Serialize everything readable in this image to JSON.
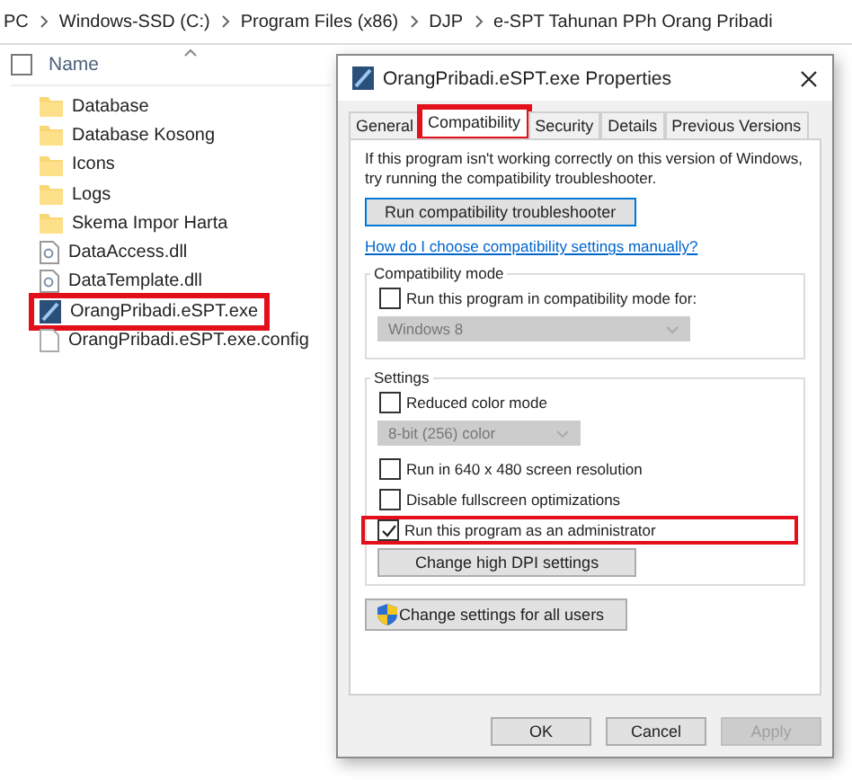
{
  "breadcrumb": [
    "PC",
    "Windows-SSD (C:)",
    "Program Files (x86)",
    "DJP",
    "e-SPT Tahunan PPh Orang Pribadi"
  ],
  "file_list": {
    "select_all": {
      "checked": false
    },
    "column": "Name",
    "items": [
      {
        "name": "Database",
        "kind": "folder",
        "highlighted": false
      },
      {
        "name": "Database Kosong",
        "kind": "folder",
        "highlighted": false
      },
      {
        "name": "Icons",
        "kind": "folder",
        "highlighted": false
      },
      {
        "name": "Logs",
        "kind": "folder",
        "highlighted": false
      },
      {
        "name": "Skema Impor Harta",
        "kind": "folder",
        "highlighted": false
      },
      {
        "name": "DataAccess.dll",
        "kind": "dll",
        "highlighted": false
      },
      {
        "name": "DataTemplate.dll",
        "kind": "dll",
        "highlighted": false
      },
      {
        "name": "OrangPribadi.eSPT.exe",
        "kind": "exe",
        "highlighted": true
      },
      {
        "name": "OrangPribadi.eSPT.exe.config",
        "kind": "file",
        "highlighted": false
      }
    ]
  },
  "dialog": {
    "title": "OrangPribadi.eSPT.exe Properties",
    "tabs": [
      {
        "label": "General",
        "selected": false,
        "highlighted": false
      },
      {
        "label": "Compatibility",
        "selected": true,
        "highlighted": true
      },
      {
        "label": "Security",
        "selected": false,
        "highlighted": false
      },
      {
        "label": "Details",
        "selected": false,
        "highlighted": false
      },
      {
        "label": "Previous Versions",
        "selected": false,
        "highlighted": false
      }
    ],
    "intro": "If this program isn't working correctly on this version of Windows, try running the compatibility troubleshooter.",
    "troubleshooter_button": "Run compatibility troubleshooter",
    "help_link": "How do I choose compatibility settings manually?",
    "groups": [
      {
        "label": "Compatibility mode",
        "items": [
          {
            "kind": "checkbox",
            "label": "Run this program in compatibility mode for:",
            "checked": false,
            "highlighted": false
          },
          {
            "kind": "dropdown",
            "value": "Windows 8",
            "disabled": true
          }
        ]
      },
      {
        "label": "Settings",
        "items": [
          {
            "kind": "checkbox",
            "label": "Reduced color mode",
            "checked": false,
            "highlighted": false
          },
          {
            "kind": "dropdown",
            "value": "8-bit (256) color",
            "disabled": true
          },
          {
            "kind": "checkbox",
            "label": "Run in 640 x 480 screen resolution",
            "checked": false,
            "highlighted": false
          },
          {
            "kind": "checkbox",
            "label": "Disable fullscreen optimizations",
            "checked": false,
            "highlighted": false
          },
          {
            "kind": "checkbox",
            "label": "Run this program as an administrator",
            "checked": true,
            "highlighted": true
          },
          {
            "kind": "button",
            "label": "Change high DPI settings"
          }
        ]
      }
    ],
    "all_users_button": "Change settings for all users",
    "buttons": [
      {
        "label": "OK",
        "disabled": false
      },
      {
        "label": "Cancel",
        "disabled": false
      },
      {
        "label": "Apply",
        "disabled": true
      }
    ]
  }
}
